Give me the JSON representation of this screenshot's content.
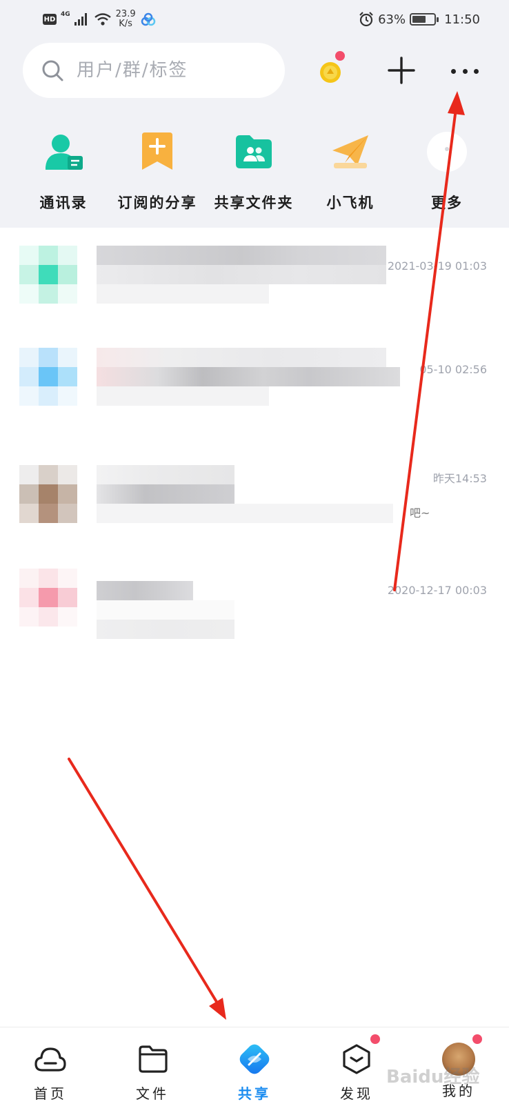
{
  "status_bar": {
    "hd": "HD",
    "network": "4G",
    "speed_value": "23.9",
    "speed_unit": "K/s",
    "battery": "63%",
    "time": "11:50"
  },
  "search": {
    "placeholder": "用户/群/标签"
  },
  "quick_actions": [
    {
      "label": "通讯录",
      "icon": "contacts-icon"
    },
    {
      "label": "订阅的分享",
      "icon": "bookmark-add-icon"
    },
    {
      "label": "共享文件夹",
      "icon": "shared-folder-icon"
    },
    {
      "label": "小飞机",
      "icon": "paper-plane-icon"
    },
    {
      "label": "更多",
      "icon": "more-icon"
    }
  ],
  "messages": [
    {
      "time": "2021-03-19 01:03",
      "snippet": ""
    },
    {
      "time": "05-10 02:56",
      "snippet": ""
    },
    {
      "time": "昨天14:53",
      "snippet": "吧~"
    },
    {
      "time": "2020-12-17 00:03",
      "snippet": ""
    }
  ],
  "tabs": [
    {
      "label": "首页",
      "icon": "cloud-home-icon"
    },
    {
      "label": "文件",
      "icon": "folder-icon"
    },
    {
      "label": "共享",
      "icon": "share-icon"
    },
    {
      "label": "发现",
      "icon": "discover-icon"
    },
    {
      "label": "我的",
      "icon": "avatar-icon"
    }
  ],
  "watermark": "Baidu经验",
  "colors": {
    "accent": "#1a8cf0",
    "badge": "#f34d6b",
    "arrow": "#e8291c",
    "header_bg": "#f1f2f6"
  }
}
